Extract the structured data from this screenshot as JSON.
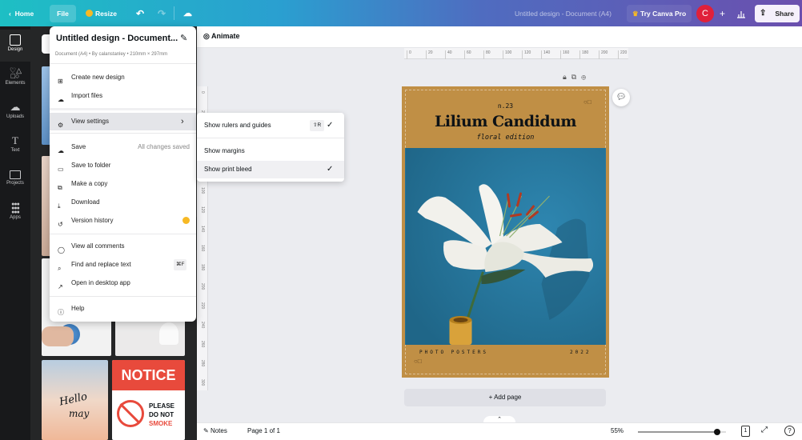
{
  "topbar": {
    "home": "Home",
    "file": "File",
    "resize": "Resize",
    "doc_title": "Untitled design - Document (A4)",
    "try_pro": "Try Canva Pro",
    "avatar_initial": "C",
    "share": "Share"
  },
  "sidebar": {
    "items": [
      {
        "label": "Design",
        "icon": "layout-icon"
      },
      {
        "label": "Elements",
        "icon": "shapes-icon"
      },
      {
        "label": "Uploads",
        "icon": "cloud-upload-icon"
      },
      {
        "label": "Text",
        "icon": "text-icon"
      },
      {
        "label": "Projects",
        "icon": "folder-icon"
      },
      {
        "label": "Apps",
        "icon": "grid-icon"
      }
    ]
  },
  "panel": {
    "notice_title": "NOTICE",
    "notice_lines": [
      "PLEASE",
      "DO NOT",
      "SMOKE"
    ],
    "hello": "Hello",
    "may": "may"
  },
  "context": {
    "animate": "Animate"
  },
  "ruler": {
    "h": [
      "0",
      "20",
      "40",
      "60",
      "80",
      "100",
      "120",
      "140",
      "160",
      "180",
      "200",
      "220"
    ],
    "v": [
      "0",
      "20",
      "40",
      "60",
      "80",
      "100",
      "120",
      "140",
      "160",
      "180",
      "200",
      "220",
      "240",
      "260",
      "280",
      "300"
    ]
  },
  "design": {
    "issue": "n.23",
    "title": "Lilium Candidum",
    "subtitle": "floral edition",
    "footer_left": "PHOTO POSTERS",
    "footer_right": "2022"
  },
  "canvas": {
    "add_page": "+ Add page"
  },
  "bottom": {
    "notes": "Notes",
    "page": "Page 1 of 1",
    "zoom": "55%",
    "zoom_percent": 55,
    "page_count": "1"
  },
  "file_menu": {
    "title": "Untitled design - Document...",
    "meta": "Document (A4) • By calanstanley • 210mm × 297mm",
    "items": {
      "create": "Create new design",
      "import": "Import files",
      "view": "View settings",
      "save": "Save",
      "save_status": "All changes saved",
      "folder": "Save to folder",
      "copy": "Make a copy",
      "download": "Download",
      "history": "Version history",
      "comments": "View all comments",
      "find": "Find and replace text",
      "find_shortcut": "⌘F",
      "desktop": "Open in desktop app",
      "help": "Help"
    }
  },
  "view_settings": {
    "items": [
      {
        "label": "Show rulers and guides",
        "shortcut": "⇧R",
        "checked": true
      },
      {
        "label": "Show margins",
        "checked": false
      },
      {
        "label": "Show print bleed",
        "checked": true
      }
    ]
  },
  "colors": {
    "accent_gradient_start": "#1ebfc4",
    "accent_gradient_end": "#6b4fae",
    "avatar": "#e0203a",
    "page": "#c08f45",
    "photo": "#2c7aa0"
  }
}
